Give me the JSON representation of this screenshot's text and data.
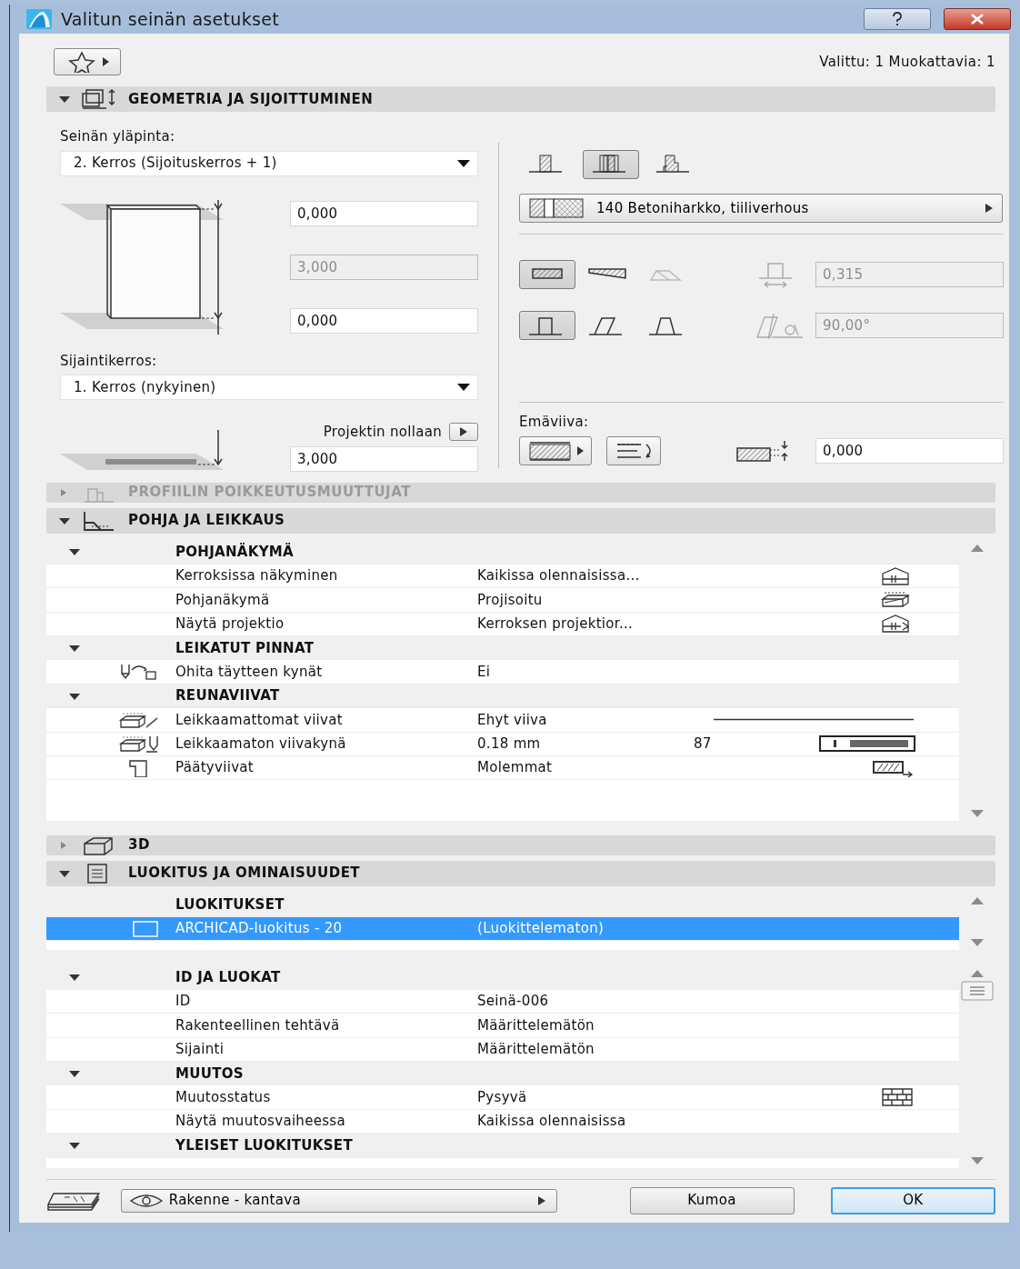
{
  "window": {
    "title": "Valitun seinän asetukset"
  },
  "selection_info": "Valittu: 1 Muokattavia: 1",
  "panels": [
    {
      "kind": "geometry",
      "title": "GEOMETRIA JA SIJOITTUMINEN",
      "expanded": true,
      "top_label": "Seinän yläpinta:",
      "top_value": "2. Kerros (Sijoituskerros + 1)",
      "height_fields": [
        {
          "value": "0,000",
          "disabled": false
        },
        {
          "value": "3,000",
          "disabled": true
        },
        {
          "value": "0,000",
          "disabled": false
        }
      ],
      "home_label": "Sijaintikerros:",
      "home_value": "1. Kerros (nykyinen)",
      "ref_label": "Projektin nollaan",
      "ref_value": "3,000",
      "structures": [
        {
          "selected": false
        },
        {
          "selected": true
        },
        {
          "selected": false
        }
      ],
      "composite": "140 Betoniharkko, tiiliverhous",
      "shapes": [
        {
          "selected": true,
          "disabled": false
        },
        {
          "selected": false,
          "disabled": false
        },
        {
          "selected": false,
          "disabled": true
        }
      ],
      "thickness": {
        "value": "0,315",
        "disabled": true
      },
      "slants": [
        {
          "selected": true
        },
        {
          "selected": false
        },
        {
          "selected": false
        }
      ],
      "angle": {
        "value": "90,00°",
        "disabled": true
      },
      "line_label": "Emäviiva:",
      "offset": {
        "value": "0,000",
        "disabled": false
      }
    },
    {
      "kind": "header",
      "title": "PROFIILIN POIKKEUTUSMUUTTUJAT",
      "expanded": false,
      "disabled": true
    },
    {
      "kind": "table",
      "title": "POHJA JA LEIKKAUS",
      "expanded": true,
      "disabled": false,
      "tables": [
        {
          "groups": [
            {
              "title": "POHJANÄKYMÄ",
              "expanded": true,
              "rows": [
                {
                  "label": "Kerroksissa näkyminen",
                  "value": "Kaikissa olennaisissa...",
                  "selected": false
                },
                {
                  "label": "Pohjanäkymä",
                  "value": "Projisoitu",
                  "selected": false
                },
                {
                  "label": "Näytä projektio",
                  "value": "Kerroksen projektior...",
                  "selected": false
                }
              ]
            },
            {
              "title": "LEIKATUT PINNAT",
              "expanded": true,
              "rows": [
                {
                  "label": "Ohita täytteen kynät",
                  "value": "Ei",
                  "selected": false
                }
              ]
            },
            {
              "title": "REUNAVIIVAT",
              "expanded": true,
              "rows": [
                {
                  "label": "Leikkaamattomat viivat",
                  "value": "Ehyt viiva",
                  "selected": false
                },
                {
                  "label": "Leikkaamaton viivakynä",
                  "value": "0.18 mm",
                  "extra": "87",
                  "selected": false
                },
                {
                  "label": "Päätyviivat",
                  "value": "Molemmat",
                  "selected": false
                }
              ]
            }
          ]
        }
      ]
    },
    {
      "kind": "header",
      "title": "3D",
      "expanded": false,
      "disabled": false
    },
    {
      "kind": "table",
      "title": "LUOKITUS JA OMINAISUUDET",
      "expanded": true,
      "disabled": false,
      "tables": [
        {
          "groups": [
            {
              "title": "LUOKITUKSET",
              "rows": [
                {
                  "label": "ARCHICAD-luokitus - 20",
                  "value": "(Luokittelematon)",
                  "selected": true
                }
              ]
            }
          ]
        },
        {
          "groups": [
            {
              "title": "ID JA LUOKAT",
              "expanded": true,
              "rows": [
                {
                  "label": "ID",
                  "value": "Seinä-006",
                  "selected": false
                },
                {
                  "label": "Rakenteellinen tehtävä",
                  "value": "Määrittelemätön",
                  "selected": false
                },
                {
                  "label": "Sijainti",
                  "value": "Määrittelemätön",
                  "selected": false
                }
              ]
            },
            {
              "title": "MUUTOS",
              "expanded": true,
              "rows": [
                {
                  "label": "Muutosstatus",
                  "value": "Pysyvä",
                  "selected": false
                },
                {
                  "label": "Näytä muutosvaiheessa",
                  "value": "Kaikissa olennaisissa",
                  "selected": false
                }
              ]
            },
            {
              "title": "YLEISET LUOKITUKSET",
              "expanded": true
            }
          ]
        }
      ]
    }
  ],
  "footer": {
    "layer": "Rakenne - kantava",
    "buttons": [
      {
        "label": "Kumoa",
        "default": false
      },
      {
        "label": "OK",
        "default": true
      }
    ]
  }
}
